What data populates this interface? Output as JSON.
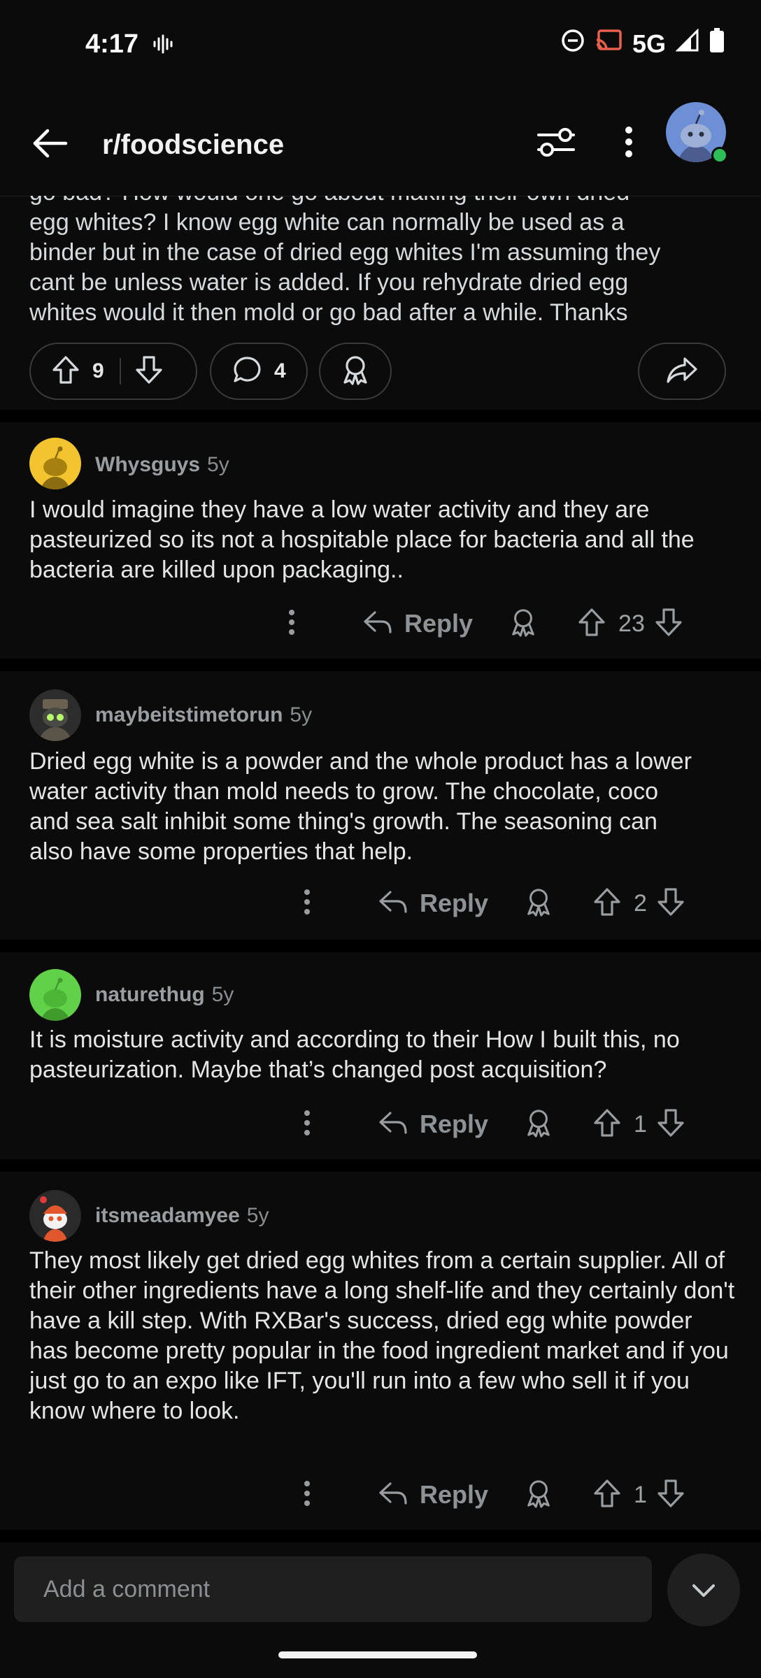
{
  "status_bar": {
    "time": "4:17",
    "network": "5G"
  },
  "header": {
    "subreddit": "r/foodscience"
  },
  "post": {
    "body_lines": [
      "go bad? How would one go about making their own dried",
      "egg whites? I know egg white can normally be used as a",
      "binder but in the case of dried egg whites I'm assuming they",
      "cant be unless water is added. If you rehydrate dried egg",
      "whites would it then mold or go bad after a while. Thanks"
    ],
    "upvotes": "9",
    "comments": "4"
  },
  "comments": [
    {
      "user": "Whysguys",
      "age": "5y",
      "text": "I would imagine they have a low water activity and they are pasteurized so its not a hospitable place for bacteria and all the bacteria are killed upon packaging..",
      "reply_label": "Reply",
      "score": "23"
    },
    {
      "user": "maybeitstimetorun",
      "age": "5y",
      "text": "Dried egg white is a powder and the whole product has a lower water activity than mold needs to grow.  The chocolate, coco and sea salt inhibit some thing's growth. The seasoning can also have some properties that help.",
      "reply_label": "Reply",
      "score": "2"
    },
    {
      "user": "naturethug",
      "age": "5y",
      "text": "It is moisture activity and according to their How I built this, no pasteurization. Maybe that’s changed post acquisition?",
      "reply_label": "Reply",
      "score": "1"
    },
    {
      "user": "itsmeadamyee",
      "age": "5y",
      "text": "They most likely get dried egg whites from a certain supplier. All of their other ingredients have a long shelf-life and they certainly don't have a kill step. With RXBar's success, dried egg white powder has become pretty popular in the food ingredient market and if you just go to an expo like IFT, you'll run into a few who sell it if you know where to look.",
      "reply_label": "Reply",
      "score": "1"
    }
  ],
  "composer": {
    "placeholder": "Add a comment"
  },
  "colors": {
    "background": "#0b0b0b",
    "online": "#2dbe58"
  }
}
